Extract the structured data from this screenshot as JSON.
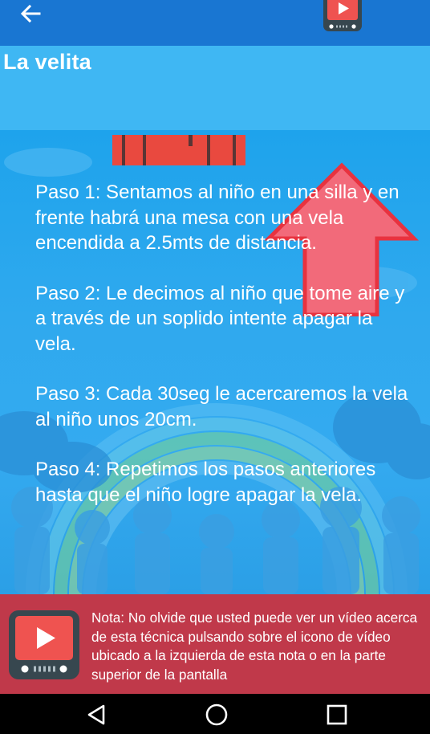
{
  "header": {
    "title": "La velita",
    "back_icon": "arrow-left-icon",
    "video_icon": "tv-play-icon"
  },
  "steps": [
    "Paso 1: Sentamos al niño en una silla y en frente habrá una mesa con una vela encendida a 2.5mts de distancia.",
    "Paso 2: Le decimos al niño que tome aire y a través de un soplido intente apagar la vela.",
    "Paso 3: Cada 30seg le acercaremos la vela al niño unos 20cm.",
    "Paso 4: Repetimos los pasos anteriores hasta que el niño logre apagar la vela."
  ],
  "note": {
    "text": "Nota: No olvide que usted puede ver un vídeo acerca de esta técnica pulsando sobre el icono de vídeo ubicado a la izquierda de esta nota o en la parte superior de la pantalla",
    "icon": "tv-play-icon"
  },
  "navbar": {
    "back_icon": "triangle-back-icon",
    "home_icon": "circle-home-icon",
    "recents_icon": "square-recents-icon"
  },
  "colors": {
    "appbar": "#1976d2",
    "title_band": "#3fb7f3",
    "note_background": "#c0394a",
    "arrow_fill": "#f26a7a",
    "arrow_stroke": "#e8323f"
  }
}
